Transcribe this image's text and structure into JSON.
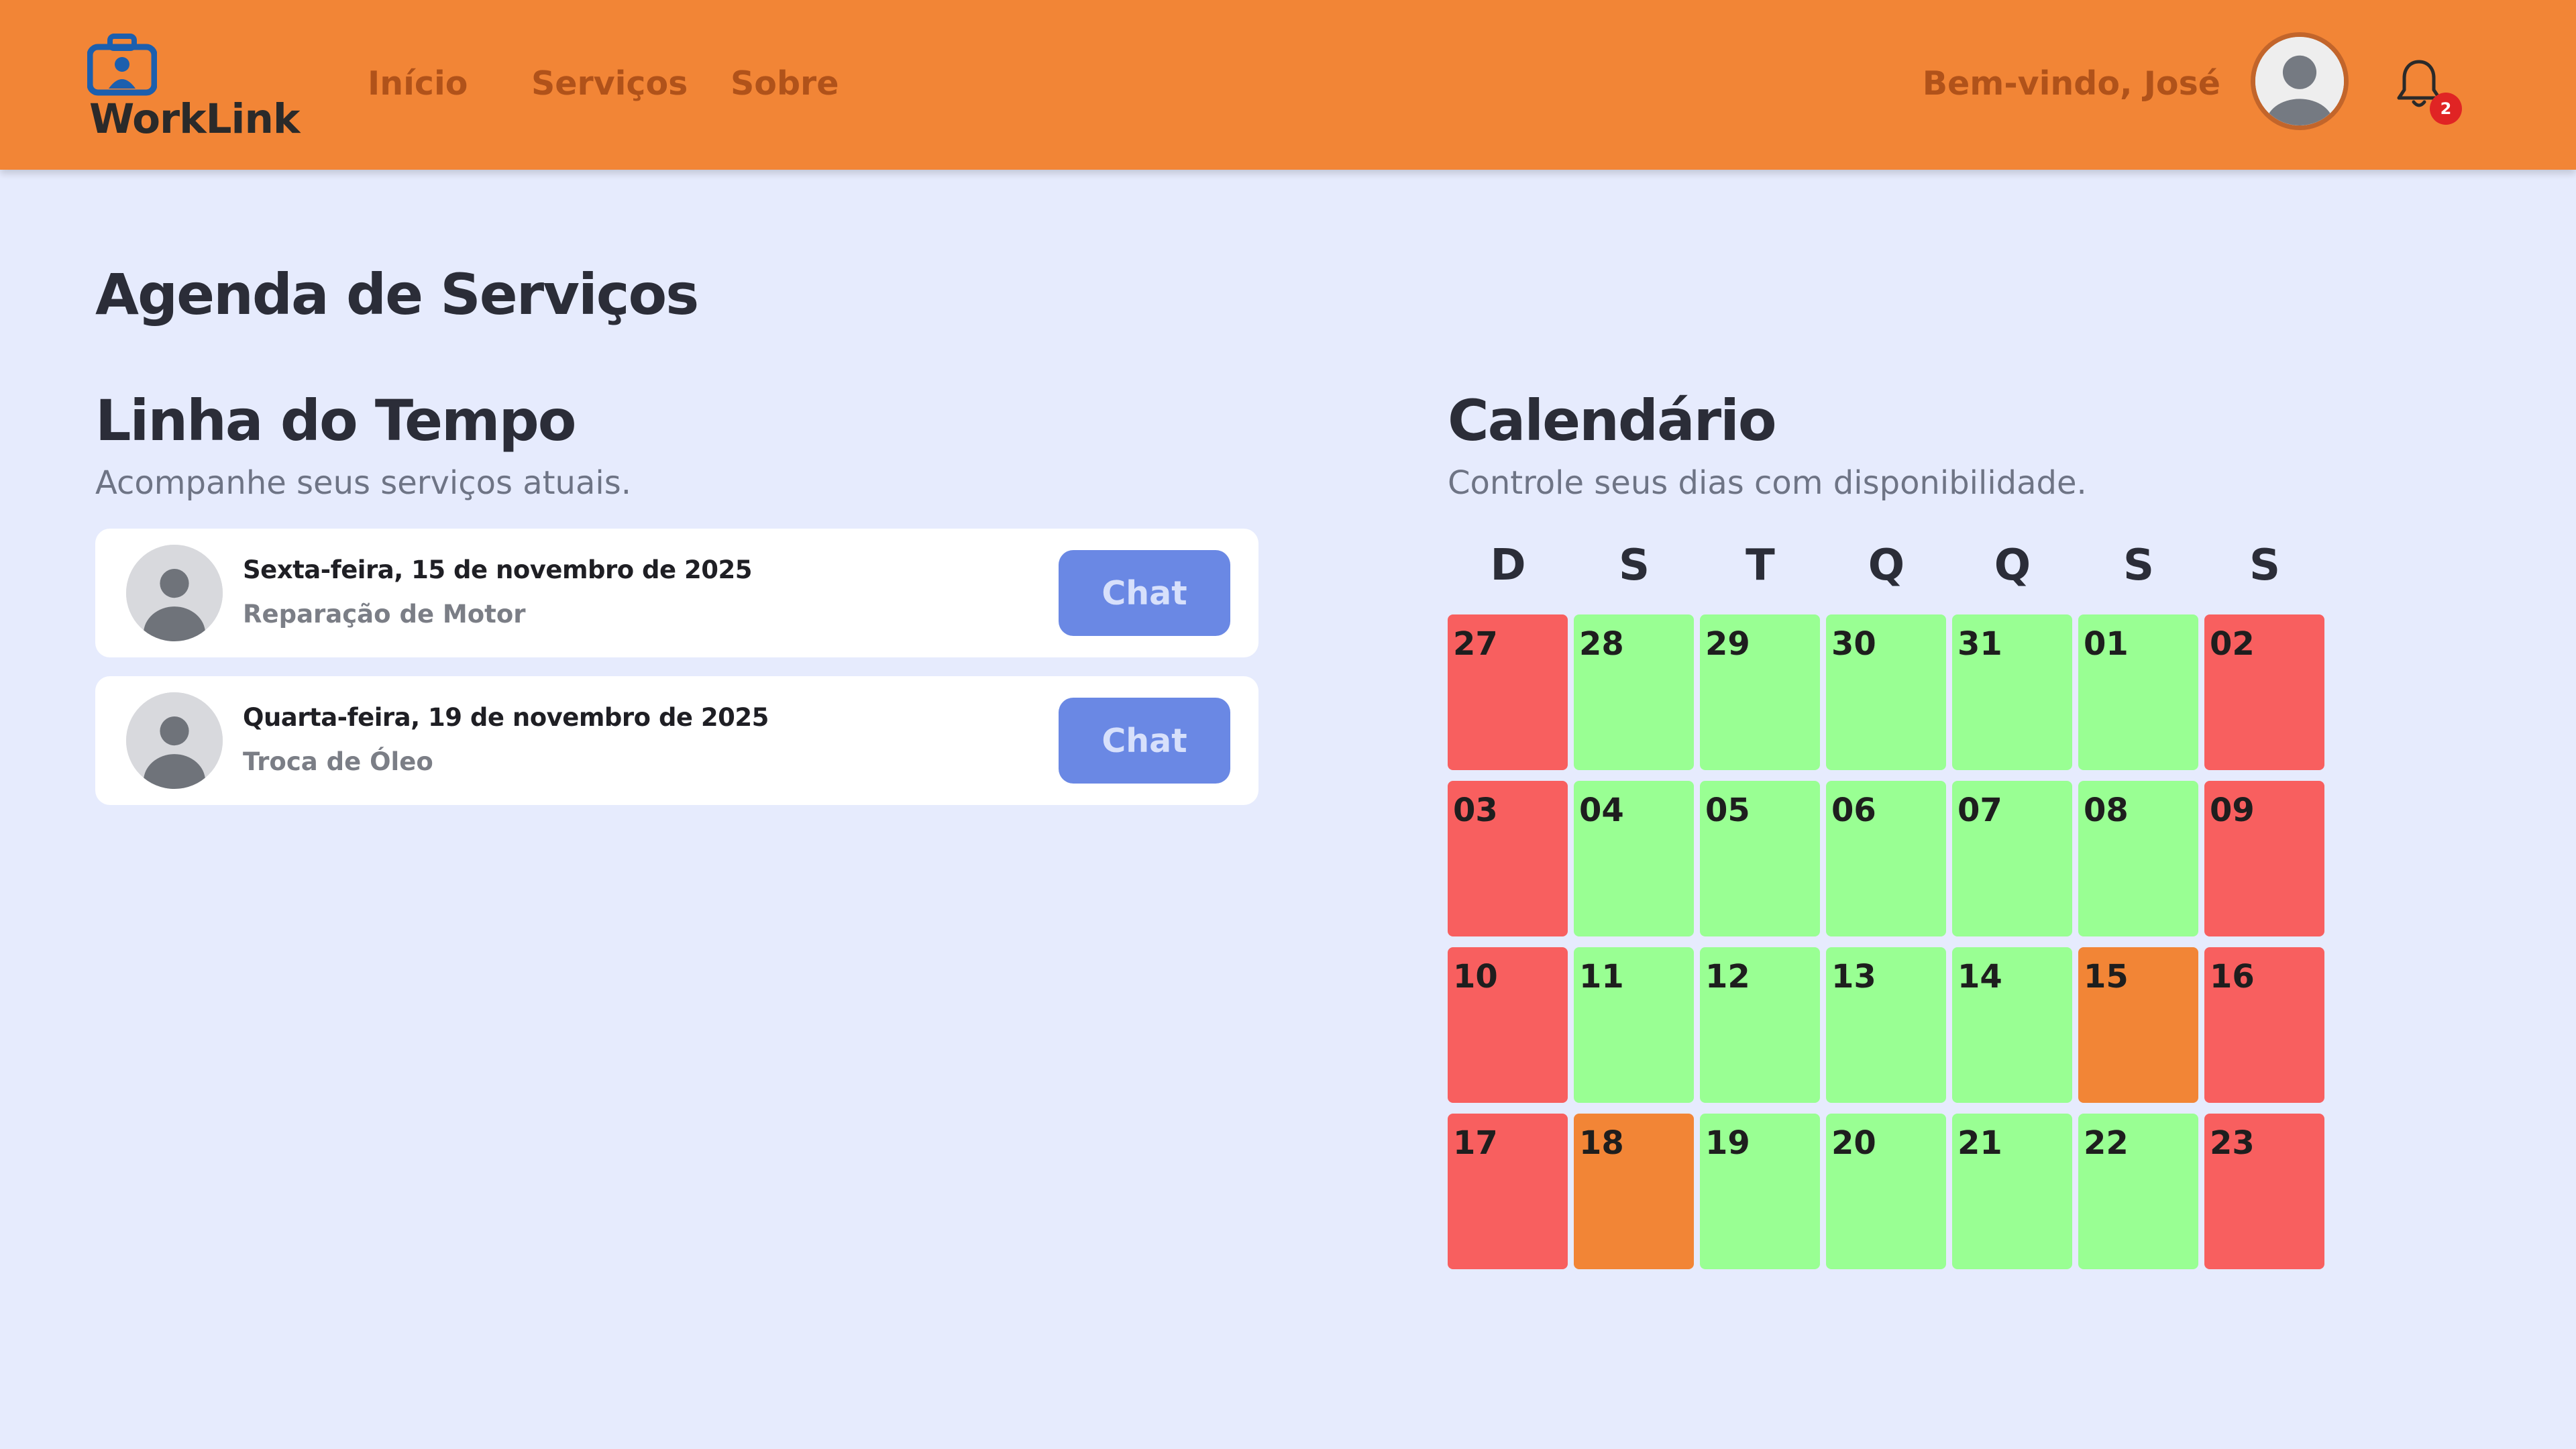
{
  "app": {
    "name": "WorkLink",
    "nav": [
      "Início",
      "Serviços",
      "Sobre"
    ],
    "welcome": "Bem-vindo, José",
    "notification_count": "2"
  },
  "page": {
    "title": "Agenda de Serviços"
  },
  "timeline": {
    "title": "Linha do Tempo",
    "subtitle": "Acompanhe seus serviços atuais.",
    "items": [
      {
        "date": "Sexta-feira, 15 de novembro de 2025",
        "service": "Reparação de Motor",
        "button": "Chat"
      },
      {
        "date": "Quarta-feira, 19 de novembro de 2025",
        "service": "Troca de Óleo",
        "button": "Chat"
      }
    ]
  },
  "calendar": {
    "title": "Calendário",
    "subtitle": "Controle seus dias com disponibilidade.",
    "weekdays": [
      "D",
      "S",
      "T",
      "Q",
      "Q",
      "S",
      "S"
    ],
    "colors": {
      "unavailable": "#f85f5f",
      "available": "#99ff93",
      "booked": "#f28536"
    },
    "weeks": [
      [
        {
          "d": "27",
          "s": "unavailable"
        },
        {
          "d": "28",
          "s": "available"
        },
        {
          "d": "29",
          "s": "available"
        },
        {
          "d": "30",
          "s": "available"
        },
        {
          "d": "31",
          "s": "available"
        },
        {
          "d": "01",
          "s": "available"
        },
        {
          "d": "02",
          "s": "unavailable"
        }
      ],
      [
        {
          "d": "03",
          "s": "unavailable"
        },
        {
          "d": "04",
          "s": "available"
        },
        {
          "d": "05",
          "s": "available"
        },
        {
          "d": "06",
          "s": "available"
        },
        {
          "d": "07",
          "s": "available"
        },
        {
          "d": "08",
          "s": "available"
        },
        {
          "d": "09",
          "s": "unavailable"
        }
      ],
      [
        {
          "d": "10",
          "s": "unavailable"
        },
        {
          "d": "11",
          "s": "available"
        },
        {
          "d": "12",
          "s": "available"
        },
        {
          "d": "13",
          "s": "available"
        },
        {
          "d": "14",
          "s": "available"
        },
        {
          "d": "15",
          "s": "booked"
        },
        {
          "d": "16",
          "s": "unavailable"
        }
      ],
      [
        {
          "d": "17",
          "s": "unavailable"
        },
        {
          "d": "18",
          "s": "booked"
        },
        {
          "d": "19",
          "s": "available"
        },
        {
          "d": "20",
          "s": "available"
        },
        {
          "d": "21",
          "s": "available"
        },
        {
          "d": "22",
          "s": "available"
        },
        {
          "d": "23",
          "s": "unavailable"
        }
      ]
    ]
  }
}
